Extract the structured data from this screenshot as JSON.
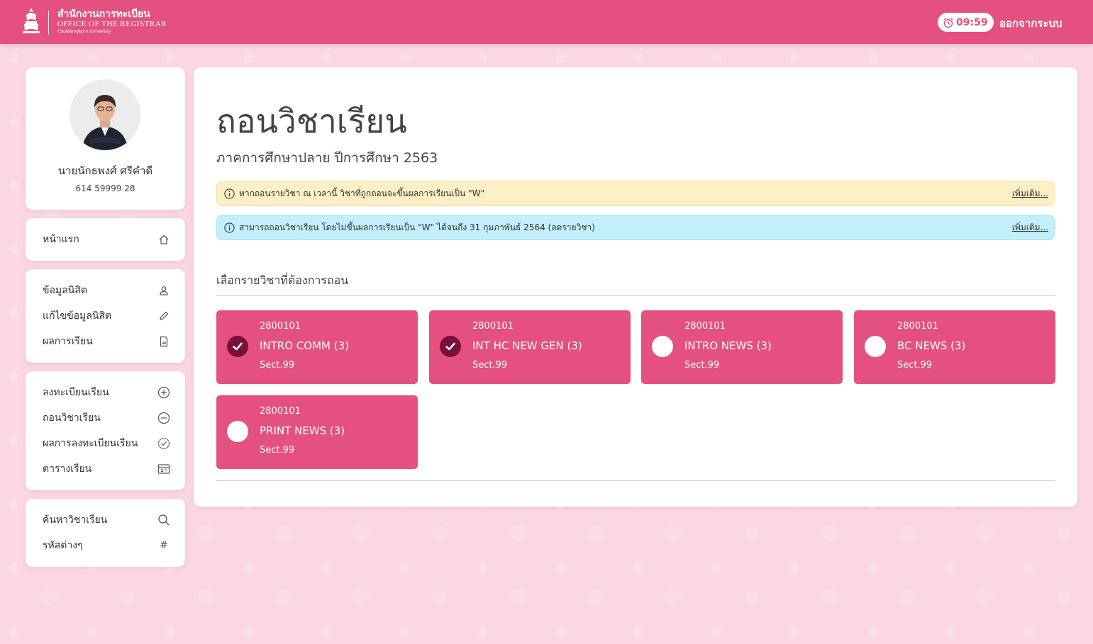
{
  "header": {
    "logo_th": "สำนักงานการทะเบียน",
    "logo_en": "OFFICE OF THE REGISTRAR",
    "logo_uni": "Chulalongkorn University",
    "timer": "09:59",
    "logout_label": "ออกจากระบบ"
  },
  "profile": {
    "name": "นายนักธพงศ์ ศรีคำดี",
    "student_id": "614 59999 28"
  },
  "sidebar": {
    "home": "หน้าแรก",
    "student_info": "ข้อมูลนิสิต",
    "edit_info": "แก้ไขข้อมูลนิสิต",
    "grades": "ผลการเรียน",
    "register": "ลงทะเบียนเรียน",
    "withdraw": "ถอนวิชาเรียน",
    "register_result": "ผลการลงทะเบียนเรียน",
    "timetable": "ตารางเรียน",
    "search_course": "ค้นหาวิชาเรียน",
    "codes": "รหัสต่างๆ"
  },
  "main": {
    "title": "ถอนวิชาเรียน",
    "subtitle": "ภาคการศึกษาปลาย ปีการศึกษา 2563",
    "alerts": [
      {
        "text": "หากถอนรายวิชา ณ เวลานี้ วิชาที่ถูกถอนจะขึ้นผลการเรียนเป็น \"W\"",
        "link": "เพิ่มเติม..."
      },
      {
        "text": "สามารถถอนวิชาเรียน โดยไม่ขึ้นผลการเรียนเป็น \"W\" ได้จนถึง 31 กุมภาพันธ์ 2564 (ลดรายวิชา)",
        "link": "เพิ่มเติม..."
      }
    ],
    "section_label": "เลือกรายวิชาที่ต้องการถอน",
    "courses": [
      {
        "code": "2800101",
        "name": "INTRO COMM (3)",
        "sect": "Sect.99",
        "selected": true
      },
      {
        "code": "2800101",
        "name": "INT HC NEW GEN (3)",
        "sect": "Sect.99",
        "selected": true
      },
      {
        "code": "2800101",
        "name": "INTRO NEWS (3)",
        "sect": "Sect.99",
        "selected": false
      },
      {
        "code": "2800101",
        "name": "BC NEWS (3)",
        "sect": "Sect.99",
        "selected": false
      },
      {
        "code": "2800101",
        "name": "PRINT NEWS (3)",
        "sect": "Sect.99",
        "selected": false
      }
    ]
  },
  "colors": {
    "brand": "#e4507f",
    "checked": "#7b0f38",
    "warning_bg": "#fdf0c6",
    "info_bg": "#c2eff9",
    "page_bg": "#fbd7e3"
  }
}
